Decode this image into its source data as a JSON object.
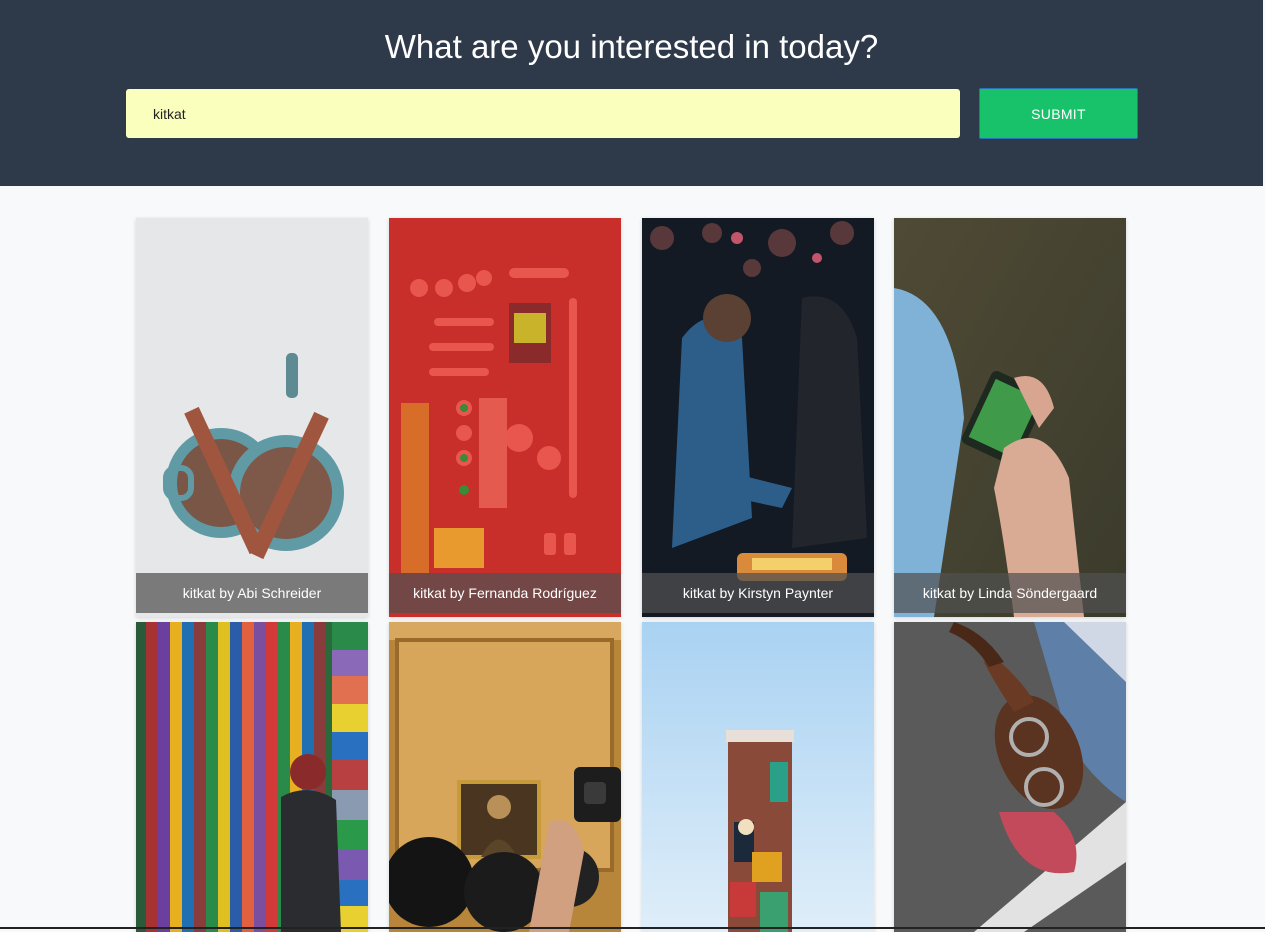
{
  "header": {
    "title": "What are you interested in today?",
    "search_value": "kitkat",
    "submit_label": "SUBMIT"
  },
  "colors": {
    "header_bg": "#2e3a4a",
    "input_bg": "#fbffbe",
    "submit_bg": "#17c26b"
  },
  "results": [
    {
      "caption": "kitkat by Abi Schreider",
      "image": "two mugs of hot chocolate with kitkat bars"
    },
    {
      "caption": "kitkat by Fernanda Rodríguez",
      "image": "red candy flat lay"
    },
    {
      "caption": "kitkat by Kirstyn Paynter",
      "image": "street food vendor at night"
    },
    {
      "caption": "kitkat by Linda Söndergaard",
      "image": "hand holding phone"
    },
    {
      "caption": "",
      "image": "person in front of striped wall"
    },
    {
      "caption": "",
      "image": "crowd photographing Mona Lisa"
    },
    {
      "caption": "",
      "image": "mural tower against blue sky"
    },
    {
      "caption": "",
      "image": "person lying on ground with sunglasses and cap"
    }
  ]
}
